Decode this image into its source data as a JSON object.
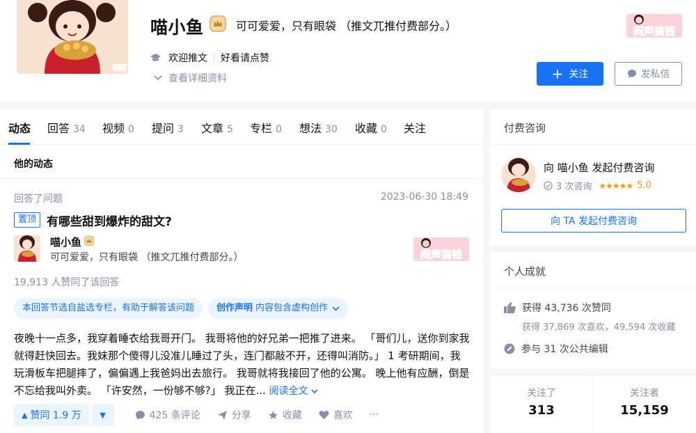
{
  "profile": {
    "name": "喵小鱼",
    "headline": "可可爱爱，只有眼袋 （推文兀推付费部分。）",
    "welcome": "欢迎推文",
    "likes_note": "好看请点赞",
    "details_link": "查看详细资料",
    "follow_button": "关注",
    "message_button": "发私信",
    "logo_text": "闷声搞钱"
  },
  "tabs": [
    {
      "label": "动态",
      "count": ""
    },
    {
      "label": "回答",
      "count": "34"
    },
    {
      "label": "视频",
      "count": "0"
    },
    {
      "label": "提问",
      "count": "3"
    },
    {
      "label": "文章",
      "count": "5"
    },
    {
      "label": "专栏",
      "count": "0"
    },
    {
      "label": "想法",
      "count": "30"
    },
    {
      "label": "收藏",
      "count": "0"
    },
    {
      "label": "关注",
      "count": ""
    }
  ],
  "feed": {
    "section_title": "他的动态",
    "action": "回答了问题",
    "time": "2023-06-30 18:49",
    "pin_label": "置顶",
    "question_title": "有哪些甜到爆炸的甜文?",
    "author_name": "喵小鱼",
    "author_headline": "可可爱爱，只有眼袋 （推文兀推付费部分。）",
    "upvote_summary": "19,913 人赞同了该回答",
    "column_note": "本回答节选自盐选专栏，有助于解答该问题",
    "claim_label": "创作声明",
    "claim_text": "内容包含虚构创作",
    "excerpt": "夜晚十一点多，我穿着睡衣给我哥开门。 我哥将他的好兄弟一把推了进来。 「哥们儿，送你到家我就得赶快回去。我妹那个傻得儿没准儿睡过了头，连门都敲不开，还得叫消防。」 1 考研期间，我玩滑板车把腿摔了，偏偏遇上我爸妈出去旅行。 我哥就将我接回了他的公寓。 晚上他有应酬，倒是不忘给我叫外卖。 「许安然，一份够不够?」 我正在...",
    "read_more": "阅读全文",
    "vote_label": "赞同 1.9 万",
    "comments": "425 条评论",
    "share": "分享",
    "collect": "收藏",
    "like": "喜欢",
    "more": "···"
  },
  "consult": {
    "title": "付费咨询",
    "invite": "向 喵小鱼 发起付费咨询",
    "count": "3 次咨询",
    "stars": "★★★★★",
    "score": "5.0",
    "button": "向 TA 发起付费咨询"
  },
  "achievements": {
    "title": "个人成就",
    "upvotes": "获得 43,736 次赞同",
    "likes_collect": "获得 37,869 次喜欢，49,594 次收藏",
    "edits": "参与 31 次公共编辑"
  },
  "follow_stats": {
    "following_label": "关注了",
    "following": "313",
    "followers_label": "关注者",
    "followers": "15,159"
  },
  "colors": {
    "accent": "#1772f6",
    "muted": "#8590a6",
    "star": "#ff9607"
  }
}
